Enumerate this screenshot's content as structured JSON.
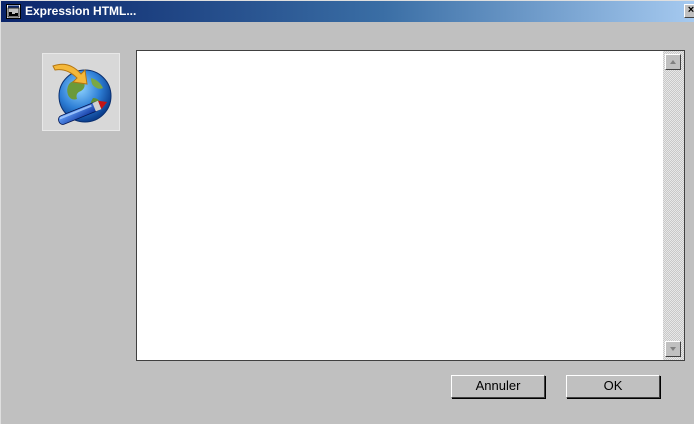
{
  "window": {
    "title": "Expression HTML...",
    "close_label": "×",
    "title_icon": "window-app-icon",
    "app_icon": "globe-pen-icon"
  },
  "editor": {
    "value": "",
    "scroll_up_icon": "scroll-up-arrow-icon",
    "scroll_down_icon": "scroll-down-arrow-icon"
  },
  "buttons": {
    "cancel_label": "Annuler",
    "ok_label": "OK"
  },
  "colors": {
    "titlebar_start": "#0a246a",
    "titlebar_end": "#a6caf0",
    "dialog_bg": "#c0c0c0"
  }
}
